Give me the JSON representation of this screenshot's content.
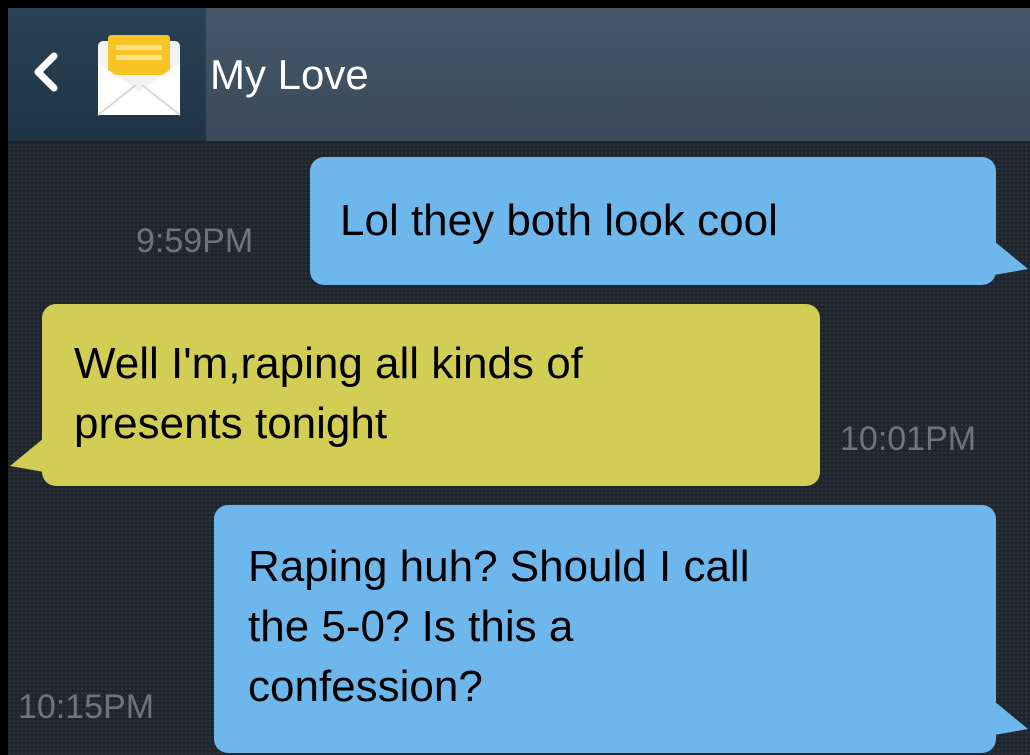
{
  "header": {
    "contact_name": "My Love",
    "back_icon": "chevron-left-icon",
    "app_icon": "envelope-icon"
  },
  "messages": [
    {
      "direction": "sent",
      "text": "Lol they both look cool",
      "time": "9:59PM"
    },
    {
      "direction": "received",
      "text": "Well I'm,raping all kinds of presents tonight",
      "lines": [
        "Well I'm,raping all kinds of",
        "presents tonight"
      ],
      "time": "10:01PM"
    },
    {
      "direction": "sent",
      "text": "Raping huh? Should I call the 5-0? Is this a confession?",
      "lines": [
        "Raping huh? Should I call",
        "the 5-0? Is this a",
        "confession?"
      ],
      "time": "10:15PM"
    }
  ],
  "colors": {
    "sent_bubble": "#6eb7ec",
    "received_bubble": "#d2cd54",
    "header": "#3a4a5a",
    "thread_background": "#20262d",
    "timestamp": "#6d747b"
  }
}
